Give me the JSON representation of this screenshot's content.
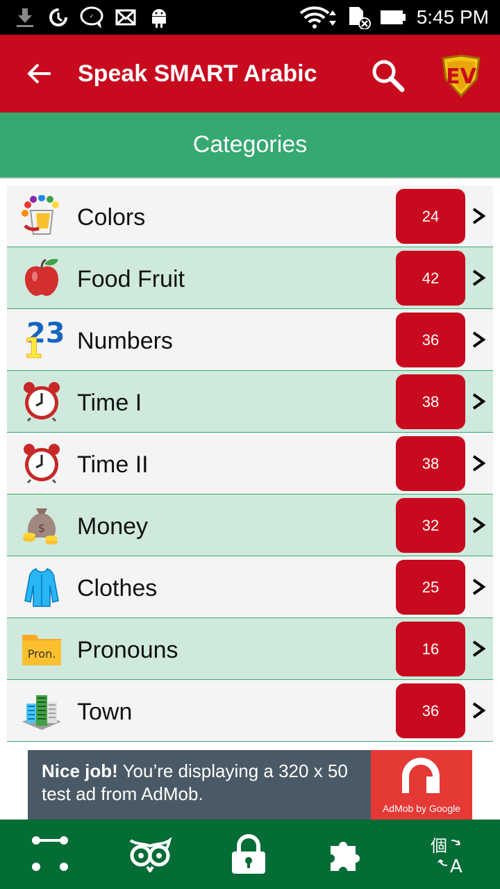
{
  "status_bar": {
    "time": "5:45 PM",
    "icons": [
      "download-icon",
      "data-saver-icon",
      "chat-bubble-icon",
      "mail-icon",
      "android-icon",
      "wifi-icon",
      "sd-card-icon",
      "battery-icon"
    ]
  },
  "app_bar": {
    "title": "Speak SMART Arabic",
    "back_icon": "arrow-left-icon",
    "search_icon": "search-icon",
    "logo_text": "EV"
  },
  "header": {
    "title": "Categories"
  },
  "categories": [
    {
      "label": "Colors",
      "count": "24",
      "icon": "paint-bucket-icon"
    },
    {
      "label": "Food Fruit",
      "count": "42",
      "icon": "apple-icon"
    },
    {
      "label": "Numbers",
      "count": "36",
      "icon": "numbers-icon"
    },
    {
      "label": "Time I",
      "count": "38",
      "icon": "alarm-clock-icon"
    },
    {
      "label": "Time II",
      "count": "38",
      "icon": "alarm-clock-icon"
    },
    {
      "label": "Money",
      "count": "32",
      "icon": "money-bag-icon"
    },
    {
      "label": "Clothes",
      "count": "25",
      "icon": "jacket-icon"
    },
    {
      "label": "Pronouns",
      "count": "16",
      "icon": "folder-icon"
    },
    {
      "label": "Town",
      "count": "36",
      "icon": "buildings-icon"
    }
  ],
  "icon_texts": {
    "numbers_top": "23",
    "numbers_front": "1",
    "pronouns_folder": "Pron."
  },
  "ad": {
    "headline": "Nice job!",
    "body": "You’re displaying a 320 x 50 test ad from AdMob.",
    "brand": "AdMob by Google"
  },
  "bottom_nav": [
    "flow-icon",
    "owl-icon",
    "lock-icon",
    "puzzle-icon",
    "translate-icon"
  ],
  "colors": {
    "app_bar": "#c80a1e",
    "header": "#36a970",
    "row_alt": "#cfe9dc",
    "badge": "#c80a1e",
    "bottom_nav": "#046c35",
    "ad_bg": "#4a5966",
    "ad_logo": "#e53935"
  }
}
